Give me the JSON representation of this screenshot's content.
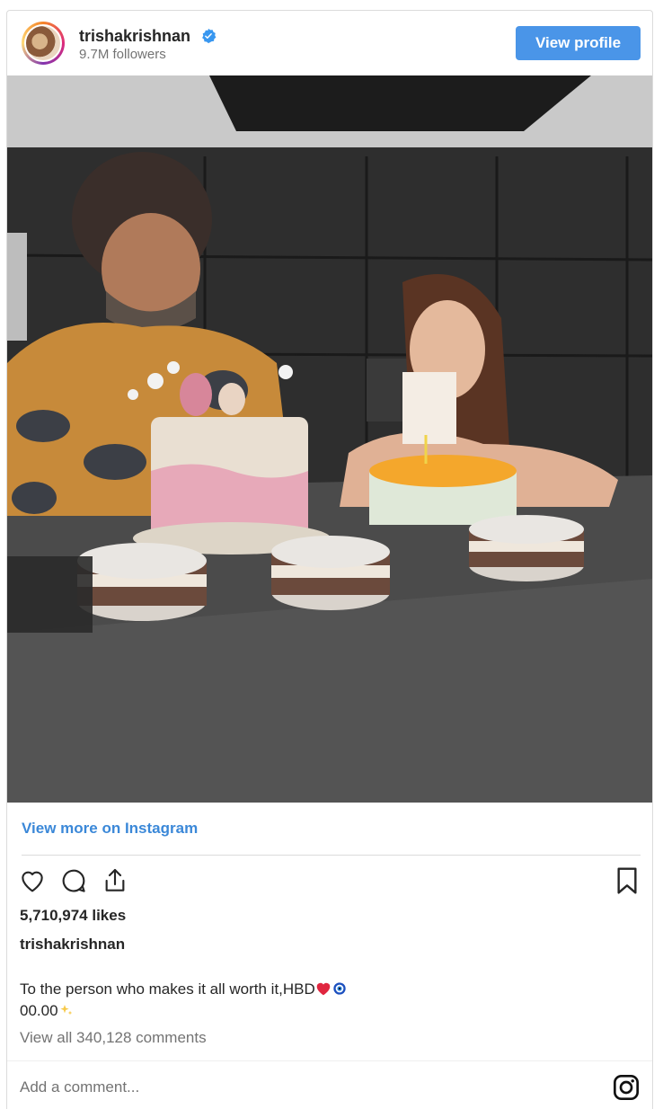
{
  "header": {
    "username": "trishakrishnan",
    "followers": "9.7M followers",
    "view_profile": "View profile"
  },
  "photo": {
    "alt": "Two people smiling behind birthday cakes on a dark kitchen counter"
  },
  "links": {
    "view_more": "View more on Instagram"
  },
  "actions": {
    "icons": [
      "heart-icon",
      "comment-icon",
      "share-icon",
      "bookmark-icon"
    ]
  },
  "post": {
    "likes": "5,710,974 likes",
    "owner": "trishakrishnan",
    "caption_line1": "To the person who makes it all worth it,HBD",
    "caption_line2": "00.00",
    "comments": "View all 340,128 comments"
  },
  "comment_box": {
    "placeholder": "Add a comment..."
  },
  "colors": {
    "accent": "#4a95e8",
    "link": "#3b88d8",
    "verified": "#3897f0",
    "muted": "#737373"
  }
}
